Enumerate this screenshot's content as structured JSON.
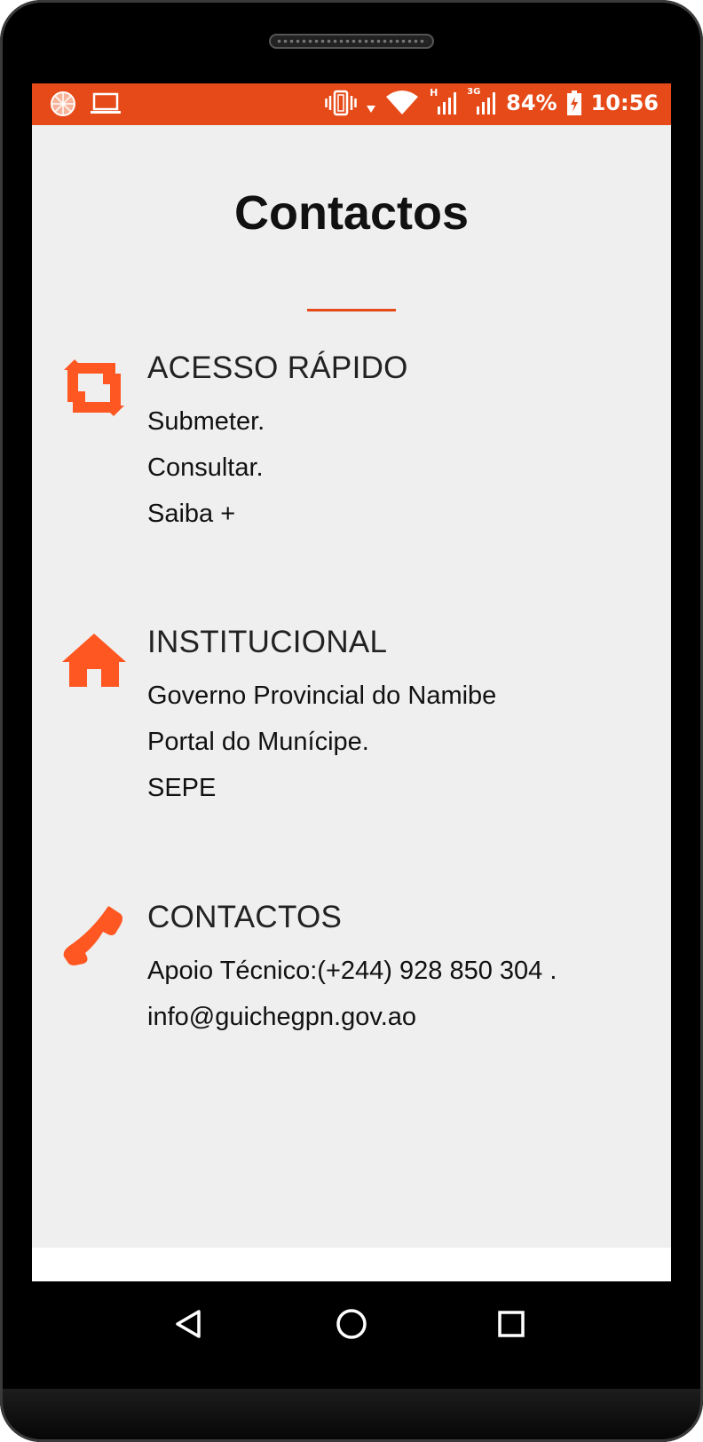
{
  "status_bar": {
    "battery": "84%",
    "time": "10:56",
    "network_h": "H",
    "network_3g": "3G"
  },
  "page": {
    "title": "Contactos"
  },
  "sections": [
    {
      "icon": "repeat-icon",
      "heading": "ACESSO RÁPIDO",
      "lines": [
        "Submeter.",
        "Consultar.",
        "Saiba +"
      ]
    },
    {
      "icon": "home-icon",
      "heading": "INSTITUCIONAL",
      "lines": [
        "Governo Provincial do Namibe",
        "Portal do Munícipe.",
        "SEPE"
      ]
    },
    {
      "icon": "phone-icon",
      "heading": "CONTACTOS",
      "lines": [
        "Apoio Técnico:(+244) 928 850 304 .",
        "info@guichegpn.gov.ao"
      ]
    }
  ],
  "colors": {
    "accent": "#e64a19",
    "icon": "#ff5722",
    "background": "#efefef"
  }
}
